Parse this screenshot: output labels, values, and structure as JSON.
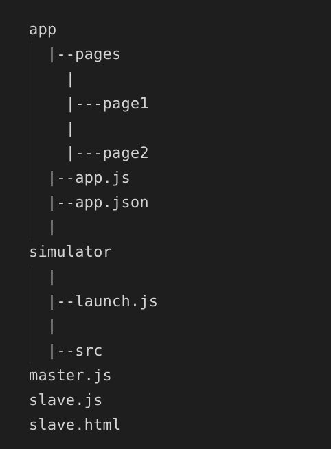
{
  "editor": {
    "background": "#1e1e1e",
    "text_color": "#d4d4d4",
    "guide_color": "#404040",
    "lines": [
      "app",
      "  |--pages",
      "    |",
      "    |---page1",
      "    |",
      "    |---page2",
      "  |--app.js",
      "  |--app.json",
      "  |",
      "simulator",
      "  |",
      "  |--launch.js",
      "  |",
      "  |--src",
      "master.js",
      "slave.js",
      "slave.html"
    ]
  }
}
